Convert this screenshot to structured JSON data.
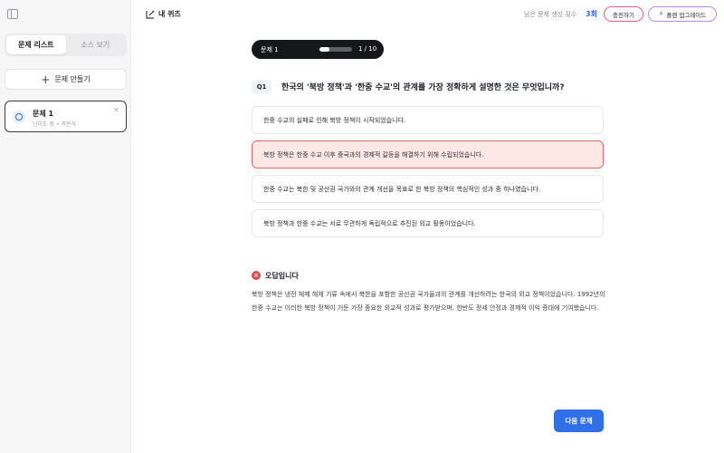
{
  "sidebar": {
    "tabs": [
      {
        "label": "문제 리스트",
        "active": true
      },
      {
        "label": "소스 보기",
        "active": false
      }
    ],
    "create_button": "문제 만들기",
    "quizzes": [
      {
        "title": "문제 1",
        "meta": "난이도 중 • 객관식"
      }
    ]
  },
  "header": {
    "title": "내 퀴즈",
    "remaining_label": "남은 문제 생성 횟수",
    "remaining_count": "3회",
    "charge_button": "충전하기",
    "upgrade_button": "플랜 업그레이드",
    "accent_color": "#2d6be4"
  },
  "progress": {
    "label": "문제 1",
    "counter": "1 / 10",
    "fraction": 0.1
  },
  "question": {
    "badge": "Q1",
    "text": "한국의 '북방 정책'과 '한중 수교'의 관계를 가장 정확하게 설명한 것은 무엇입니까?",
    "options": [
      {
        "text": "한중 수교의 실패로 인해 북방 정책이 시작되었습니다.",
        "state": "default"
      },
      {
        "text": "북방 정책은 한중 수교 이후 중국과의 경제적 갈등을 해결하기 위해 수립되었습니다.",
        "state": "wrong"
      },
      {
        "text": "한중 수교는 북한 및 공산권 국가와의 관계 개선을 목표로 한 북방 정책의 핵심적인 성과 중 하나였습니다.",
        "state": "default"
      },
      {
        "text": "북방 정책과 한중 수교는 서로 무관하게 독립적으로 추진된 외교 활동이었습니다.",
        "state": "default"
      }
    ]
  },
  "feedback": {
    "title": "오답입니다",
    "body": "북방 정책은 냉전 체제 해체 기류 속에서 북한을 포함한 공산권 국가들과의 관계를 개선하려는 한국의 외교 정책이었습니다. 1992년의 한중 수교는 이러한 북방 정책이 거둔 가장 중요한 외교적 성과로 평가받으며, 한반도 정세 안정과 경제적 이익 증대에 기여했습니다.",
    "error_color": "#e5484d"
  },
  "next_button": "다음 문제"
}
